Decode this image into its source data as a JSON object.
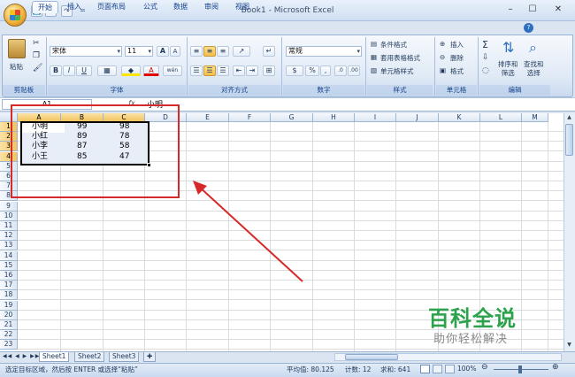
{
  "window": {
    "title": "Book1 - Microsoft Excel",
    "controls": [
      "–",
      "☐",
      "✕"
    ]
  },
  "qat": {
    "save": "💾",
    "undo": "↶",
    "redo": "↷",
    "customize": "="
  },
  "tabs": [
    {
      "label": "开始",
      "active": true
    },
    {
      "label": "插入"
    },
    {
      "label": "页面布局"
    },
    {
      "label": "公式"
    },
    {
      "label": "数据"
    },
    {
      "label": "审阅"
    },
    {
      "label": "视图"
    }
  ],
  "help": {
    "label": "?"
  },
  "ribbon": {
    "clipboard": {
      "label": "剪贴板",
      "paste": "粘贴"
    },
    "font": {
      "label": "字体",
      "name": "宋体",
      "size": "11",
      "bold": "B",
      "italic": "I",
      "underline": "U",
      "grow": "A",
      "shrink": "A",
      "font_color": "A",
      "phonetic": "wén"
    },
    "alignment": {
      "label": "对齐方式"
    },
    "number": {
      "label": "数字",
      "format": "常规",
      "percent": "%",
      "comma": ","
    },
    "styles": {
      "label": "样式",
      "conditional": "条件格式",
      "table": "套用表格格式",
      "cell": "单元格样式"
    },
    "cells": {
      "label": "单元格",
      "insert": "插入",
      "delete": "删除",
      "format": "格式"
    },
    "editing": {
      "label": "编辑",
      "sigma": "Σ",
      "sort": "排序和\n筛选",
      "find": "查找和\n选择"
    }
  },
  "formula_bar": {
    "name_box": "A1",
    "fx": "fx",
    "content": "小明"
  },
  "columns": [
    "A",
    "B",
    "C",
    "D",
    "E",
    "F",
    "G",
    "H",
    "I",
    "J",
    "K",
    "L",
    "M"
  ],
  "rows": [
    "1",
    "2",
    "3",
    "4",
    "5",
    "6",
    "7",
    "8",
    "9",
    "10",
    "11",
    "12",
    "13",
    "14",
    "15",
    "16",
    "17",
    "18",
    "19",
    "20",
    "21",
    "22",
    "23"
  ],
  "table": [
    [
      "小明",
      "99",
      "98"
    ],
    [
      "小红",
      "89",
      "78"
    ],
    [
      "小李",
      "87",
      "58"
    ],
    [
      "小王",
      "85",
      "47"
    ]
  ],
  "sheets": [
    "Sheet1",
    "Sheet2",
    "Sheet3"
  ],
  "status": {
    "message": "选定目标区域，然后按 ENTER 或选择“粘贴”",
    "average": "平均值: 80.125",
    "count": "计数: 12",
    "sum": "求和: 641",
    "zoom": "100%"
  },
  "watermark": {
    "title": "百科全说",
    "subtitle": "助你轻松解决"
  },
  "colors": {
    "annotation": "#d62a2a",
    "selection": "#f3c25e",
    "watermark": "#2ca24c"
  }
}
